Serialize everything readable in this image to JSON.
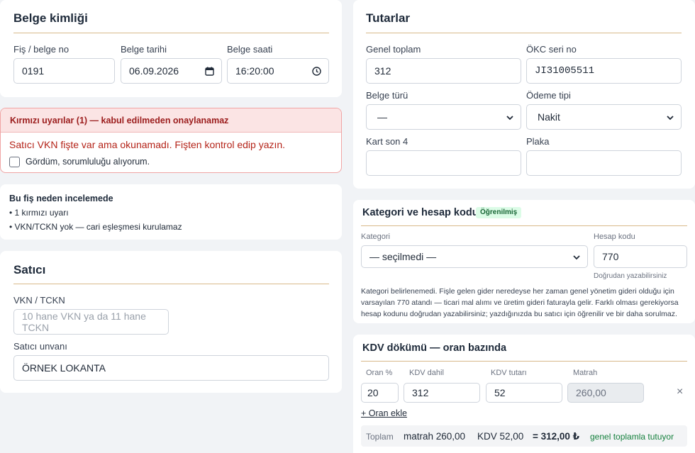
{
  "belge": {
    "title": "Belge kimliği",
    "fis_label": "Fiş / belge no",
    "fis_value": "0191",
    "tarih_label": "Belge tarihi",
    "tarih_value": "06.09.2026",
    "saat_label": "Belge saati",
    "saat_value": "16:20:00"
  },
  "uyari": {
    "title": "Kırmızı uyarılar (1) — kabul edilmeden onaylanamaz",
    "message": "Satıcı VKN fişte var ama okunamadı. Fişten kontrol edip yazın.",
    "checkbox_label": "Gördüm, sorumluluğu alıyorum.",
    "checked": false,
    "color": "#b42318"
  },
  "inceleme": {
    "title": "Bu fiş neden incelemede",
    "items": [
      "• 1 kırmızı uyarı",
      "• VKN/TCKN yok — cari eşleşmesi kurulamaz"
    ]
  },
  "satici": {
    "title": "Satıcı",
    "vkn_label": "VKN / TCKN",
    "vkn_placeholder": "10 hane VKN ya da 11 hane TCKN",
    "unvan_label": "Satıcı unvanı",
    "unvan_value": "ÖRNEK LOKANTA"
  },
  "tutarlar": {
    "title": "Tutarlar",
    "genel_label": "Genel toplam",
    "genel_value": "312",
    "okc_label": "ÖKC seri no",
    "okc_value": "JI31005511",
    "belge_turu_label": "Belge türü",
    "belge_turu_value": "—",
    "odeme_label": "Ödeme tipi",
    "odeme_value": "Nakit",
    "kart_label": "Kart son 4",
    "kart_value": "",
    "plaka_label": "Plaka",
    "plaka_value": ""
  },
  "kategori": {
    "title": "Kategori ve hesap kodu",
    "badge": "Öğrenilmiş",
    "kategori_label": "Kategori",
    "kategori_value": "— seçilmedi —",
    "hesap_label": "Hesap kodu",
    "hesap_value": "770",
    "hesap_hint": "Doğrudan yazabilirsiniz",
    "note_line1": "Kategori belirlenemedi. Fişle gelen gider neredeyse her zaman genel yönetim gideri olduğu için",
    "note_line2": "varsayılan 770 atandı — ticari mal alımı ve üretim gideri faturayla gelir. Farklı olması gerekiyorsa",
    "note_line3": "hesap kodunu doğrudan yazabilirsiniz; yazdığınızda bu satıcı için öğrenilir ve bir daha sorulmaz."
  },
  "kdv": {
    "title": "KDV dökümü — oran bazında",
    "col_oran": "Oran %",
    "col_dahil": "KDV dahil",
    "col_tutar": "KDV tutarı",
    "col_matrah": "Matrah",
    "row_oran": "20",
    "row_dahil": "312",
    "row_tutar": "52",
    "row_matrah": "260,00",
    "remove": "×",
    "add": "+ Oran ekle",
    "toplam_label": "Toplam",
    "toplam_matrah": "matrah 260,00",
    "toplam_kdv": "KDV 52,00",
    "toplam_total": "= 312,00 ₺",
    "toplam_status": "genel toplamla tutuyor",
    "status_color": "#15803d"
  }
}
